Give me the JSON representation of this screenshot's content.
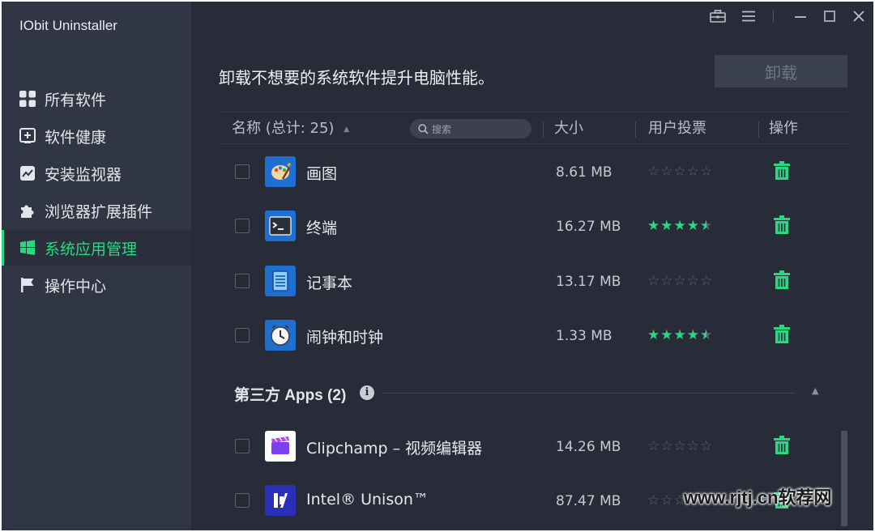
{
  "app": {
    "title": "IObit Uninstaller"
  },
  "sidebar": {
    "items": [
      {
        "label": "所有软件",
        "icon": "grid-icon"
      },
      {
        "label": "软件健康",
        "icon": "health-plus-icon"
      },
      {
        "label": "安装监视器",
        "icon": "monitor-chart-icon"
      },
      {
        "label": "浏览器扩展插件",
        "icon": "puzzle-icon"
      },
      {
        "label": "系统应用管理",
        "icon": "windows-icon",
        "active": true
      },
      {
        "label": "操作中心",
        "icon": "flag-icon"
      }
    ]
  },
  "header": {
    "headline": "卸载不想要的系统软件提升电脑性能。",
    "uninstall_label": "卸载"
  },
  "table": {
    "col_name": "名称 (总计: 25)",
    "search_placeholder": "搜索",
    "col_size": "大小",
    "col_votes": "用户投票",
    "col_action": "操作"
  },
  "apps": [
    {
      "name": "画图",
      "size": "8.61 MB",
      "rating": 0,
      "icon": "paint-icon"
    },
    {
      "name": "终端",
      "size": "16.27 MB",
      "rating": 4.5,
      "icon": "terminal-icon"
    },
    {
      "name": "记事本",
      "size": "13.17 MB",
      "rating": 0,
      "icon": "notepad-icon"
    },
    {
      "name": "闹钟和时钟",
      "size": "1.33 MB",
      "rating": 4.5,
      "icon": "alarm-clock-icon"
    }
  ],
  "third_party": {
    "title": "第三方 Apps (2)",
    "apps": [
      {
        "name": "Clipchamp – 视频编辑器",
        "size": "14.26 MB",
        "rating": 0,
        "icon": "clipchamp-icon"
      },
      {
        "name": "Intel® Unison™",
        "size": "87.47 MB",
        "rating": 0,
        "icon": "intel-unison-icon"
      }
    ]
  },
  "watermark": "www.rjtj.cn软荐网",
  "colors": {
    "accent": "#2bd882",
    "background": "#282c38",
    "sidebar": "#303643"
  }
}
